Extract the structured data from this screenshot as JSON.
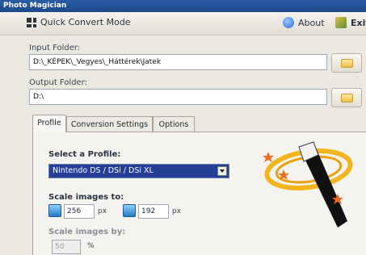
{
  "window": {
    "title": "Photo Magician"
  },
  "menu": {
    "quick_convert": "Quick Convert Mode",
    "about": "About",
    "exit": "Exit"
  },
  "input_folder": {
    "label": "Input Folder:",
    "value": "D:\\_KÉPEK\\_Vegyes\\_Háttérek\\Jatek"
  },
  "output_folder": {
    "label": "Output Folder:",
    "value": "D:\\"
  },
  "tabs": [
    {
      "label": "Profile",
      "active": true
    },
    {
      "label": "Conversion Settings",
      "active": false
    },
    {
      "label": "Options",
      "active": false
    }
  ],
  "profile": {
    "select_label": "Select a Profile:",
    "selected": "Nintendo DS / DSi / DSi XL",
    "scale_to_label": "Scale images to:",
    "width": "256",
    "height": "192",
    "unit": "px",
    "scale_by_label": "Scale images by:",
    "scale_by_value": "50",
    "percent": "%"
  },
  "colors": {
    "titlebar": "#1d4989",
    "selected_profile_bg": "#243f95",
    "wand_ring": "#f2b51e",
    "stars": "#f06a1f"
  },
  "icons": [
    "grid-icon",
    "info-icon",
    "exit-icon",
    "folder-icon",
    "scale-width-icon",
    "scale-height-icon",
    "magic-wand-icon"
  ]
}
